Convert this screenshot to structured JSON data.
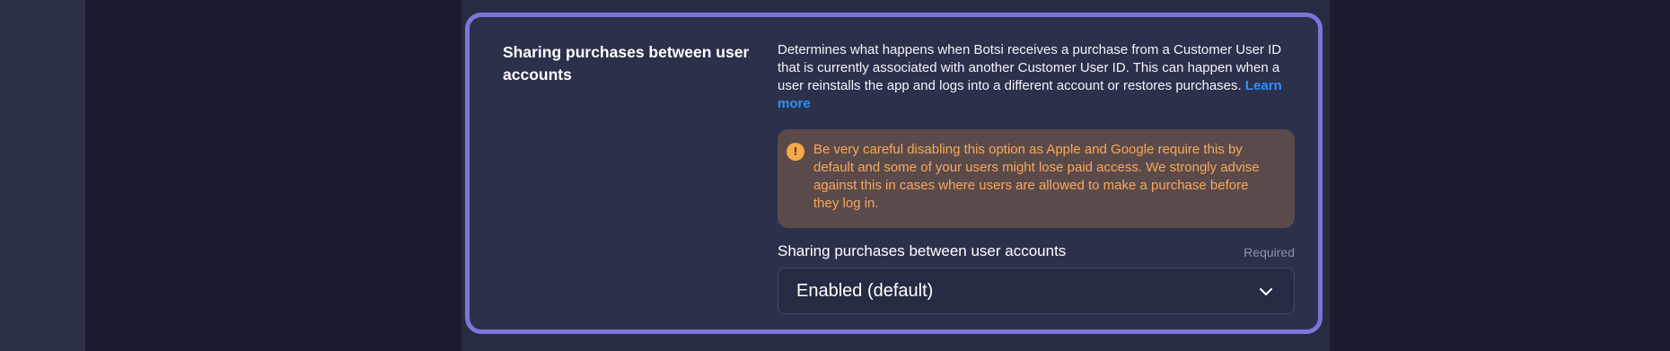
{
  "section": {
    "title": "Sharing purchases between user accounts",
    "description": "Determines what happens when Botsi receives a purchase from a Customer User ID that is currently associated with another Customer User ID. This can happen when a user reinstalls the app and logs into a different account or restores purchases.",
    "learn_more": "Learn more"
  },
  "warning": {
    "icon": "exclamation-circle-icon",
    "icon_glyph": "!",
    "text": "Be very careful disabling this option as Apple and Google require this by default and some of your users might lose paid access. We strongly advise against this in cases where users are allowed to make a purchase before they log in.",
    "color": "#f6a85a"
  },
  "field": {
    "label": "Sharing purchases between user accounts",
    "required": "Required",
    "selected_value": "Enabled (default)"
  },
  "colors": {
    "accent_border": "#7a75d6",
    "link": "#2f8fff",
    "warning_bg": "#5b4a4a"
  }
}
